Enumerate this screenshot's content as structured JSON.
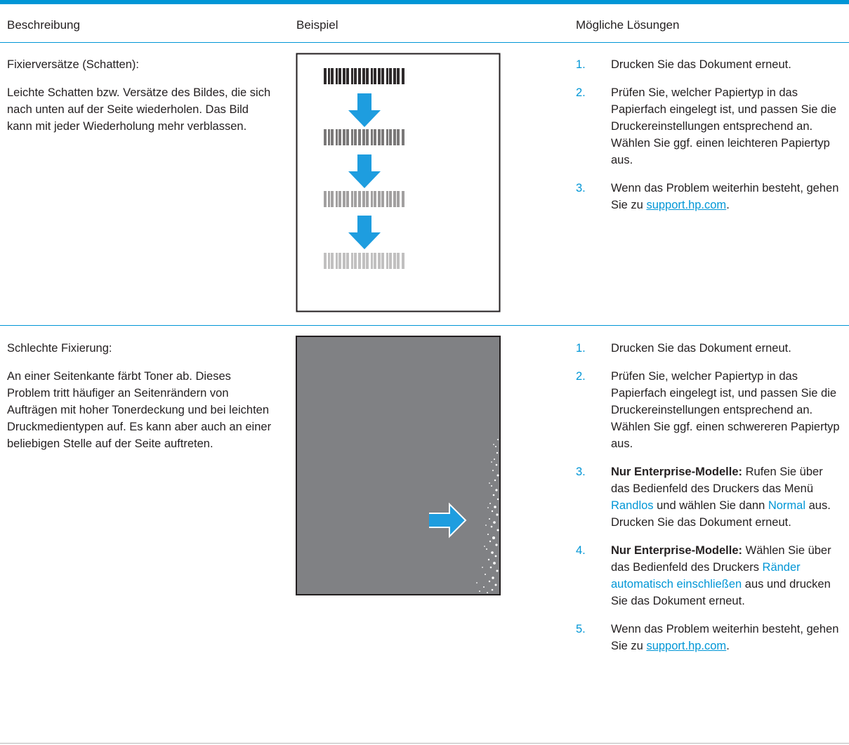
{
  "header": {
    "col_description": "Beschreibung",
    "col_example": "Beispiel",
    "col_solutions": "Mögliche Lösungen"
  },
  "colors": {
    "accent": "#0096d6",
    "arrow": "#1e9ddf",
    "sample_gray": "#808184"
  },
  "rows": [
    {
      "title": "Fixierversätze (Schatten):",
      "text": "Leichte Schatten bzw. Versätze des Bildes, die sich nach unten auf der Seite wiederholen. Das Bild kann mit jeder Wiederholung mehr verblassen.",
      "solutions": [
        {
          "num": "1.",
          "text": "Drucken Sie das Dokument erneut."
        },
        {
          "num": "2.",
          "text": "Prüfen Sie, welcher Papiertyp in das Papierfach eingelegt ist, und passen Sie die Druckereinstellungen entsprechend an. Wählen Sie ggf. einen leichteren Papiertyp aus."
        },
        {
          "num": "3.",
          "text_before": "Wenn das Problem weiterhin besteht, gehen Sie zu ",
          "link": "support.hp.com",
          "text_after": "."
        }
      ]
    },
    {
      "title": "Schlechte Fixierung:",
      "text": "An einer Seitenkante färbt Toner ab. Dieses Problem tritt häufiger an Seitenrändern von Aufträgen mit hoher Tonerdeckung und bei leichten Druckmedientypen auf. Es kann aber auch an einer beliebigen Stelle auf der Seite auftreten.",
      "solutions": [
        {
          "num": "1.",
          "text": "Drucken Sie das Dokument erneut."
        },
        {
          "num": "2.",
          "text": "Prüfen Sie, welcher Papiertyp in das Papierfach eingelegt ist, und passen Sie die Druckereinstellungen entsprechend an. Wählen Sie ggf. einen schwereren Papiertyp aus."
        },
        {
          "num": "3.",
          "bold": "Nur Enterprise-Modelle:",
          "t1": " Rufen Sie über das Bedienfeld des Druckers das Menü ",
          "ui1": "Randlos",
          "t2": " und wählen Sie dann ",
          "ui2": "Normal",
          "t3": " aus. Drucken Sie das Dokument erneut."
        },
        {
          "num": "4.",
          "bold": "Nur Enterprise-Modelle:",
          "t1": " Wählen Sie über das Bedienfeld des Druckers ",
          "ui1": "Ränder automatisch einschließen",
          "t2": " aus und drucken Sie das Dokument erneut."
        },
        {
          "num": "5.",
          "text_before": "Wenn das Problem weiterhin besteht, gehen Sie zu ",
          "link": "support.hp.com",
          "text_after": "."
        }
      ]
    }
  ]
}
